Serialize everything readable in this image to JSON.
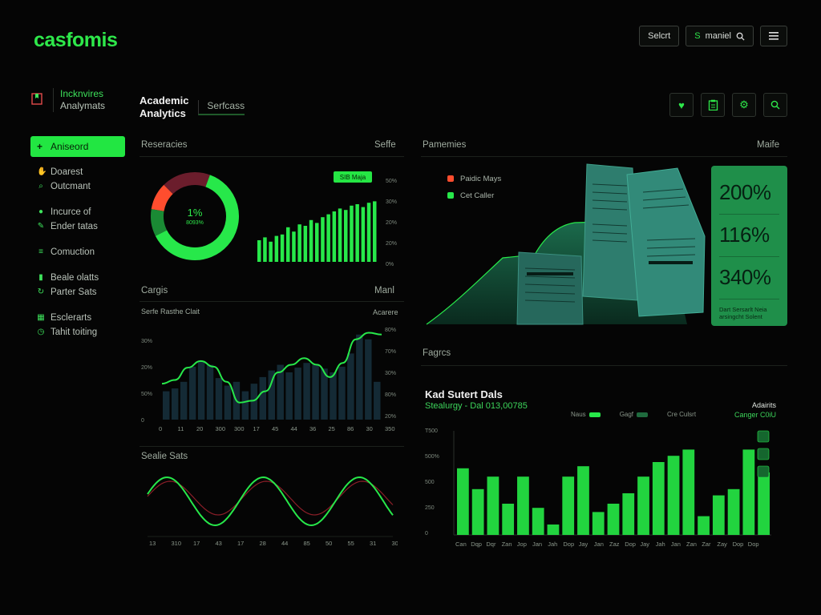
{
  "app": {
    "logo": "casfomis"
  },
  "topbar": {
    "select_label": "Selcrt",
    "search_label": "maniel",
    "search_prefix": "S",
    "menu_icon": "hamburger-icon"
  },
  "sidebar": {
    "brand_line1": "Incknvires",
    "brand_line2": "Analymats",
    "active_item": "Aniseord",
    "groups": [
      [
        {
          "icon": "hand-icon",
          "label": "Doarest"
        },
        {
          "icon": "search-icon",
          "label": "Outcmant"
        }
      ],
      [
        {
          "icon": "pin-icon",
          "label": "Incurce of"
        },
        {
          "icon": "edit-icon",
          "label": "Ender tatas"
        }
      ],
      [
        {
          "icon": "list-icon",
          "label": "Comuction"
        }
      ],
      [
        {
          "icon": "bar-icon",
          "label": "Beale olatts"
        },
        {
          "icon": "refresh-icon",
          "label": "Parter Sats"
        }
      ],
      [
        {
          "icon": "calendar-icon",
          "label": "Esclerarts"
        },
        {
          "icon": "clock-icon",
          "label": "Tahit toiting"
        }
      ]
    ]
  },
  "header": {
    "title_line1": "Academic",
    "title_line2": "Analytics",
    "subtitle": "Serfcass",
    "icons": [
      "heart-icon",
      "clipboard-icon",
      "gear-icon",
      "search-icon"
    ]
  },
  "panels": {
    "resercies": {
      "label": "Reseracies",
      "right": "Seffe"
    },
    "pamemies": {
      "label": "Pamemies",
      "right": "Maife"
    },
    "cargis": {
      "label": "Cargis",
      "right": "Manl"
    },
    "fagrcs": {
      "label": "Fagrcs"
    },
    "sealie": {
      "label": "Sealie Sats"
    }
  },
  "donut": {
    "center_value": "1%",
    "center_sub": "8093%",
    "segments": [
      {
        "name": "green-main",
        "value": 62,
        "color": "#27e84a"
      },
      {
        "name": "green-dark",
        "value": 10,
        "color": "#1a8a34"
      },
      {
        "name": "orange",
        "value": 10,
        "color": "#ff4d2e"
      },
      {
        "name": "maroon",
        "value": 18,
        "color": "#6b1d2c"
      }
    ]
  },
  "mini_bars": {
    "badge": "SIB Maja",
    "values": [
      30,
      34,
      28,
      36,
      38,
      48,
      42,
      52,
      50,
      58,
      54,
      62,
      66,
      70,
      74,
      72,
      78,
      80,
      76,
      82,
      84
    ],
    "ticks": [
      "50%",
      "30%",
      "20%",
      "20%",
      "0%"
    ]
  },
  "legend_pamemies": [
    {
      "label": "Paidic Mays",
      "color": "#ff4d2e"
    },
    {
      "label": "Cet Caller",
      "color": "#27e84a"
    }
  ],
  "metrics": {
    "values": [
      "200%",
      "116%",
      "340%"
    ],
    "foot_line1": "Dart Sersarlt Neia",
    "foot_line2": "arsingcht Solent"
  },
  "line_bar": {
    "subtitle": "Serfe Rasthe Clait",
    "right_label": "Acarere",
    "left_ticks": [
      "30%",
      "20%",
      "50%",
      "0"
    ],
    "right_ticks": [
      "80%",
      "70%",
      "30%",
      "80%",
      "20%"
    ],
    "x_ticks": [
      "0",
      "11",
      "20",
      "300",
      "300",
      "17",
      "45",
      "44",
      "36",
      "25",
      "86",
      "30",
      "350"
    ],
    "bar_values": [
      30,
      33,
      40,
      56,
      62,
      58,
      44,
      36,
      40,
      30,
      38,
      45,
      52,
      58,
      50,
      55,
      60,
      58,
      54,
      50,
      56,
      70,
      90,
      85,
      40
    ],
    "line_values": [
      38,
      42,
      55,
      62,
      56,
      40,
      18,
      20,
      30,
      50,
      58,
      65,
      58,
      45,
      60,
      85,
      92,
      90
    ]
  },
  "sine": {
    "x_ticks": [
      "13",
      "310",
      "17",
      "43",
      "17",
      "28",
      "44",
      "85",
      "50",
      "55",
      "31",
      "300"
    ]
  },
  "big_bars": {
    "title": "Kad Sutert Dals",
    "subtitle": "Stealurgy - Dal 013,00785",
    "legend": [
      {
        "label": "Naus",
        "color": "#27e84a"
      },
      {
        "label": "Gagf",
        "color": "#1f6b3e"
      },
      {
        "label": "Cre Culsrt",
        "color": ""
      }
    ],
    "corner_title": "Adairits",
    "corner_sub": "Canger C0iU",
    "y_ticks": [
      "T500",
      "500%",
      "500",
      "250",
      "0"
    ],
    "x_ticks": [
      "Can",
      "Dqp",
      "Dqr",
      "Zan",
      "Jop",
      "Jan",
      "Jah",
      "Dop",
      "Jay",
      "Jan",
      "Zaz",
      "Dop",
      "Jay",
      "Jah",
      "Jan",
      "Zan",
      "Zar",
      "Zay",
      "Dop",
      "Dop"
    ],
    "values": [
      64,
      44,
      56,
      30,
      56,
      26,
      10,
      56,
      66,
      22,
      30,
      40,
      56,
      70,
      76,
      82,
      18,
      38,
      44,
      82,
      60
    ]
  }
}
